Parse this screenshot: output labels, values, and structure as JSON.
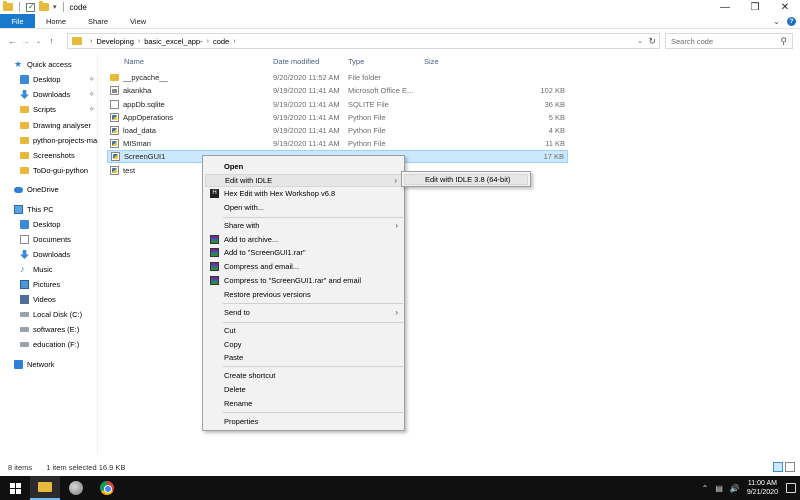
{
  "window": {
    "title": "code",
    "controls": {
      "minimize": "—",
      "maximize": "❒",
      "close": "✕"
    }
  },
  "ribbon": {
    "tabs": [
      "File",
      "Home",
      "Share",
      "View"
    ]
  },
  "address": {
    "breadcrumb": [
      "Developing",
      "basic_excel_app-",
      "code"
    ],
    "search_placeholder": "Search code"
  },
  "sidebar": {
    "items": [
      {
        "label": "Quick access",
        "icon": "star-icon"
      },
      {
        "label": "Desktop",
        "icon": "desktop-icon",
        "pinned": true
      },
      {
        "label": "Downloads",
        "icon": "downloads-icon",
        "pinned": true
      },
      {
        "label": "Scripts",
        "icon": "folder-icon",
        "pinned": true
      },
      {
        "label": "Drawing analyser",
        "icon": "folder-icon"
      },
      {
        "label": "python-projects-ma",
        "icon": "folder-icon"
      },
      {
        "label": "Screenshots",
        "icon": "folder-icon"
      },
      {
        "label": "ToDo-gui-python",
        "icon": "folder-icon"
      },
      {
        "label": "OneDrive",
        "icon": "onedrive-icon"
      },
      {
        "label": "This PC",
        "icon": "this-pc-icon"
      },
      {
        "label": "Desktop",
        "icon": "desktop-icon"
      },
      {
        "label": "Documents",
        "icon": "documents-icon"
      },
      {
        "label": "Downloads",
        "icon": "downloads-icon"
      },
      {
        "label": "Music",
        "icon": "music-icon"
      },
      {
        "label": "Pictures",
        "icon": "pictures-icon"
      },
      {
        "label": "Videos",
        "icon": "videos-icon"
      },
      {
        "label": "Local Disk (C:)",
        "icon": "drive-icon"
      },
      {
        "label": "softwares (E:)",
        "icon": "drive-icon"
      },
      {
        "label": "education (F:)",
        "icon": "drive-icon"
      },
      {
        "label": "Network",
        "icon": "network-icon"
      }
    ]
  },
  "columns": {
    "name": "Name",
    "date": "Date modified",
    "type": "Type",
    "size": "Size"
  },
  "files": [
    {
      "name": "__pycache__",
      "date": "9/20/2020 11:52 AM",
      "type": "File folder",
      "size": "",
      "icon": "folder-icon"
    },
    {
      "name": "akankha",
      "date": "9/19/2020 11:41 AM",
      "type": "Microsoft Office E...",
      "size": "102 KB",
      "icon": "excel-file-icon"
    },
    {
      "name": "appDb.sqlite",
      "date": "9/19/2020 11:41 AM",
      "type": "SQLITE File",
      "size": "36 KB",
      "icon": "file-icon"
    },
    {
      "name": "AppOperations",
      "date": "9/19/2020 11:41 AM",
      "type": "Python File",
      "size": "5 KB",
      "icon": "python-file-icon"
    },
    {
      "name": "load_data",
      "date": "9/19/2020 11:41 AM",
      "type": "Python File",
      "size": "4 KB",
      "icon": "python-file-icon"
    },
    {
      "name": "MISman",
      "date": "9/19/2020 11:41 AM",
      "type": "Python File",
      "size": "11 KB",
      "icon": "python-file-icon"
    },
    {
      "name": "ScreenGUI1",
      "date": "",
      "type": "",
      "size": "17 KB",
      "icon": "python-file-icon",
      "selected": true
    },
    {
      "name": "test",
      "date": "",
      "type": "",
      "size": "",
      "icon": "python-file-icon"
    }
  ],
  "context_menu": {
    "items": [
      {
        "label": "Open",
        "bold": true
      },
      {
        "label": "Edit with IDLE",
        "submenu": true,
        "hover": true
      },
      {
        "label": "Hex Edit with Hex Workshop v6.8",
        "icon": "hex-workshop-icon"
      },
      {
        "label": "Open with..."
      },
      {
        "label": "Share with",
        "submenu": true
      },
      {
        "label": "Add to archive...",
        "icon": "winrar-icon"
      },
      {
        "label": "Add to \"ScreenGUI1.rar\"",
        "icon": "winrar-icon"
      },
      {
        "label": "Compress and email...",
        "icon": "winrar-icon"
      },
      {
        "label": "Compress to \"ScreenGUI1.rar\" and email",
        "icon": "winrar-icon"
      },
      {
        "label": "Restore previous versions"
      },
      {
        "label": "Send to",
        "submenu": true
      },
      {
        "label": "Cut"
      },
      {
        "label": "Copy"
      },
      {
        "label": "Paste"
      },
      {
        "label": "Create shortcut"
      },
      {
        "label": "Delete"
      },
      {
        "label": "Rename"
      },
      {
        "label": "Properties"
      }
    ],
    "submenu_item": "Edit with IDLE 3.8 (64-bit)"
  },
  "status": {
    "count": "8 items",
    "selection": "1 item selected  16.9 KB"
  },
  "taskbar": {
    "time": "11:00 AM",
    "date": "9/21/2020"
  }
}
